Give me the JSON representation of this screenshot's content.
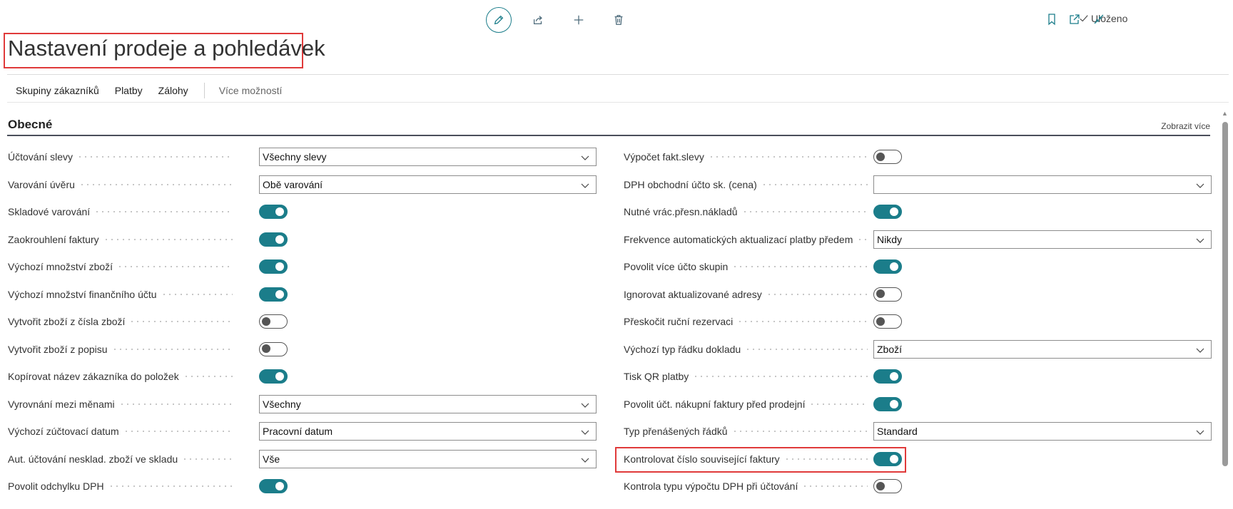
{
  "toolbar": {
    "icons": [
      "pencil-icon",
      "share-icon",
      "plus-icon",
      "trash-icon"
    ],
    "saved_label": "Uloženo",
    "right_icons": [
      "bookmark-icon",
      "open-new-window-icon",
      "collapse-icon"
    ]
  },
  "page": {
    "title": "Nastavení prodeje a pohledávek"
  },
  "actions": {
    "items": [
      "Skupiny zákazníků",
      "Platby",
      "Zálohy"
    ],
    "more": "Více možností"
  },
  "section": {
    "title": "Obecné",
    "show_more": "Zobrazit více"
  },
  "left_fields": [
    {
      "label": "Účtování slevy",
      "type": "select",
      "value": "Všechny slevy"
    },
    {
      "label": "Varování úvěru",
      "type": "select",
      "value": "Obě varování"
    },
    {
      "label": "Skladové varování",
      "type": "toggle",
      "value": true
    },
    {
      "label": "Zaokrouhlení faktury",
      "type": "toggle",
      "value": true
    },
    {
      "label": "Výchozí množství zboží",
      "type": "toggle",
      "value": true
    },
    {
      "label": "Výchozí množství finančního účtu",
      "type": "toggle",
      "value": true
    },
    {
      "label": "Vytvořit zboží z čísla zboží",
      "type": "toggle",
      "value": false
    },
    {
      "label": "Vytvořit zboží z popisu",
      "type": "toggle",
      "value": false
    },
    {
      "label": "Kopírovat název zákazníka do položek",
      "type": "toggle",
      "value": true
    },
    {
      "label": "Vyrovnání mezi měnami",
      "type": "select",
      "value": "Všechny"
    },
    {
      "label": "Výchozí zúčtovací datum",
      "type": "select",
      "value": "Pracovní datum"
    },
    {
      "label": "Aut. účtování nesklad. zboží ve skladu",
      "type": "select",
      "value": "Vše"
    },
    {
      "label": "Povolit odchylku DPH",
      "type": "toggle",
      "value": true
    }
  ],
  "right_fields": [
    {
      "label": "Výpočet fakt.slevy",
      "type": "toggle",
      "value": false
    },
    {
      "label": "DPH obchodní účto sk. (cena)",
      "type": "select",
      "value": ""
    },
    {
      "label": "Nutné vrác.přesn.nákladů",
      "type": "toggle",
      "value": true
    },
    {
      "label": "Frekvence automatických aktualizací platby předem",
      "type": "select",
      "value": "Nikdy"
    },
    {
      "label": "Povolit více účto skupin",
      "type": "toggle",
      "value": true
    },
    {
      "label": "Ignorovat aktualizované adresy",
      "type": "toggle",
      "value": false
    },
    {
      "label": "Přeskočit ruční rezervaci",
      "type": "toggle",
      "value": false
    },
    {
      "label": "Výchozí typ řádku dokladu",
      "type": "select",
      "value": "Zboží"
    },
    {
      "label": "Tisk QR platby",
      "type": "toggle",
      "value": true
    },
    {
      "label": "Povolit účt. nákupní faktury před prodejní",
      "type": "toggle",
      "value": true
    },
    {
      "label": "Typ přenášených řádků",
      "type": "select",
      "value": "Standard"
    },
    {
      "label": "Kontrolovat číslo související faktury",
      "type": "toggle",
      "value": true,
      "highlighted": true
    },
    {
      "label": "Kontrola typu výpočtu DPH při účtování",
      "type": "toggle",
      "value": false
    }
  ],
  "colors": {
    "accent": "#1b7d8a",
    "highlight": "#e03a3a"
  }
}
